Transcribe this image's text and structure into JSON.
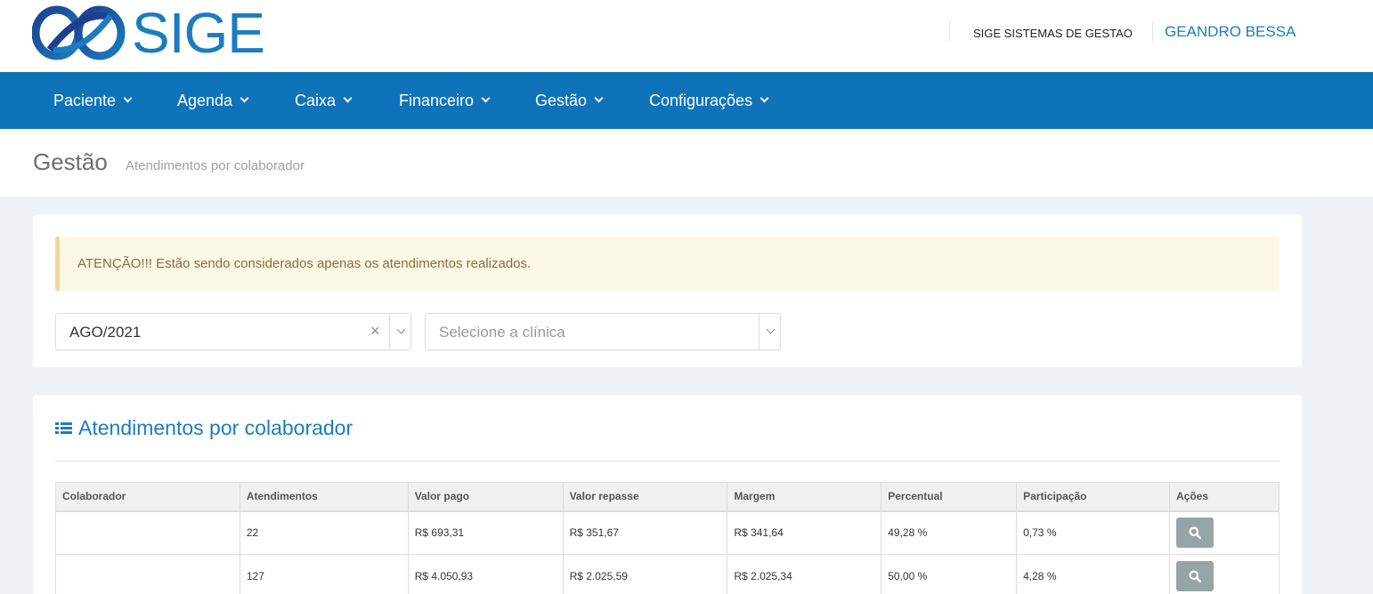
{
  "header": {
    "logo_text": "SIGE",
    "company": "SIGE SISTEMAS DE GESTAO",
    "user": "GEANDRO BESSA"
  },
  "nav": [
    {
      "label": "Paciente"
    },
    {
      "label": "Agenda"
    },
    {
      "label": "Caixa"
    },
    {
      "label": "Financeiro"
    },
    {
      "label": "Gestão"
    },
    {
      "label": "Configurações"
    }
  ],
  "page": {
    "title": "Gestão",
    "subtitle": "Atendimentos por colaborador"
  },
  "filters": {
    "alert": "ATENÇÃO!!! Estão sendo considerados apenas os atendimentos realizados.",
    "period": {
      "value": "AGO/2021",
      "clear_icon": "×"
    },
    "clinic": {
      "placeholder": "Selecione a clínica"
    }
  },
  "report": {
    "title": "Atendimentos por colaborador",
    "columns": [
      "Colaborador",
      "Atendimentos",
      "Valor pago",
      "Valor repasse",
      "Margem",
      "Percentual",
      "Participação",
      "Ações"
    ],
    "rows": [
      {
        "colaborador": "",
        "atendimentos": "22",
        "valor_pago": "R$ 693,31",
        "valor_repasse": "R$ 351,67",
        "margem": "R$ 341,64",
        "percentual": "49,28 %",
        "participacao": "0,73 %"
      },
      {
        "colaborador": "",
        "atendimentos": "127",
        "valor_pago": "R$ 4.050,93",
        "valor_repasse": "R$ 2.025,59",
        "margem": "R$ 2.025,34",
        "percentual": "50,00 %",
        "participacao": "4,28 %"
      }
    ]
  },
  "colors": {
    "brand": "#1b7cc0",
    "navbar": "#0f73b9",
    "alert_bg": "#fcf8e6",
    "action_button": "#95a5a6"
  }
}
